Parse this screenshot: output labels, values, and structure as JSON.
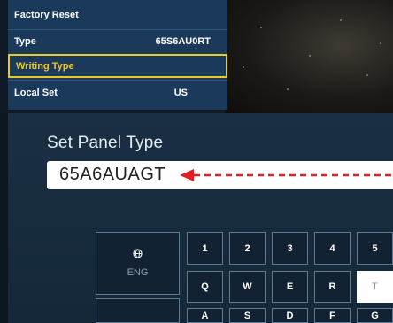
{
  "menu": {
    "items": [
      {
        "label": "Factory Reset",
        "value": ""
      },
      {
        "label": "Type",
        "value": "65S6AU0RT"
      },
      {
        "label": "Writing Type",
        "value": ""
      },
      {
        "label": "Local Set",
        "value": "US"
      }
    ]
  },
  "panel": {
    "title": "Set Panel Type",
    "input_value": "65A6AUAGT"
  },
  "keyboard": {
    "lang_label": "ENG",
    "lang_icon": "globe-icon",
    "row1": [
      "1",
      "2",
      "3",
      "4",
      "5"
    ],
    "row2": [
      "Q",
      "W",
      "E",
      "R",
      "T"
    ],
    "row3": [
      "A",
      "S",
      "D",
      "F",
      "G"
    ]
  },
  "colors": {
    "menu_bg": "#1b3a5b",
    "selection": "#e7c92a",
    "arrow": "#e02020",
    "panel_bg": "#1a2f44"
  }
}
